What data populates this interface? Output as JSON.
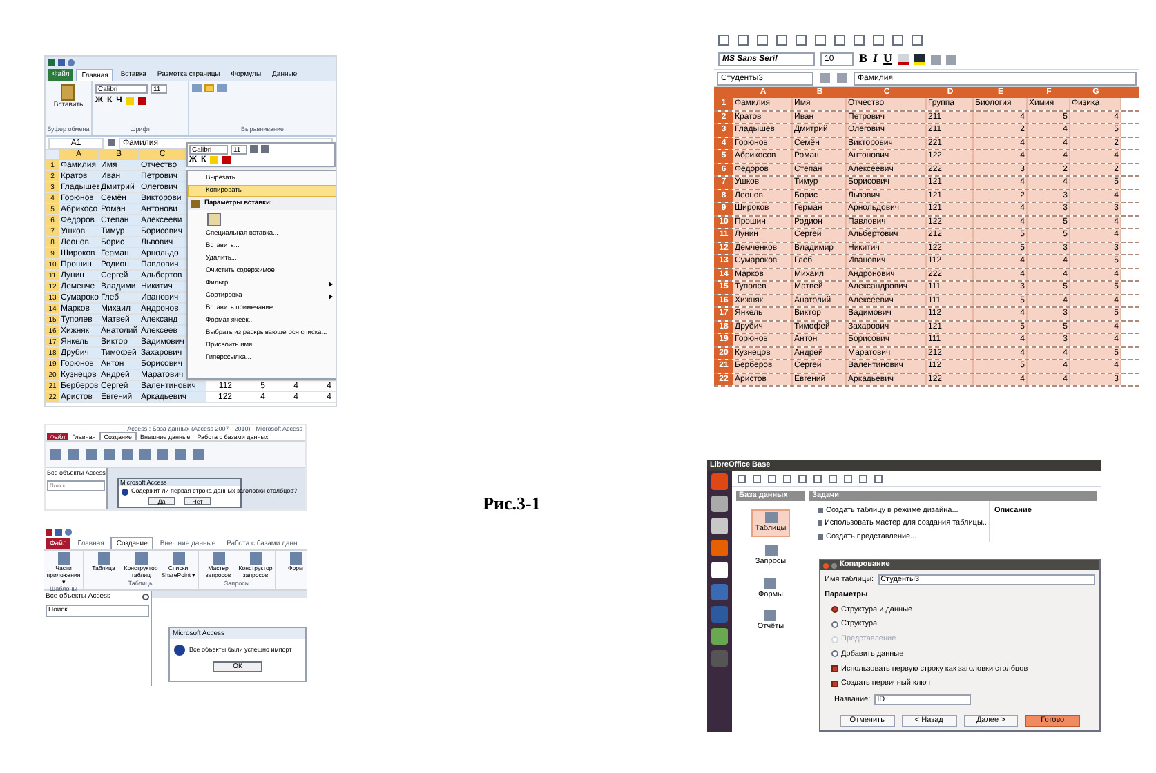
{
  "excel": {
    "tabs": [
      {
        "label": "Файл",
        "kind": "file",
        "selected": false
      },
      {
        "label": "Главная",
        "kind": "tab",
        "selected": true
      },
      {
        "label": "Вставка",
        "kind": "tab",
        "selected": false
      },
      {
        "label": "Разметка страницы",
        "kind": "tab",
        "selected": false
      },
      {
        "label": "Формулы",
        "kind": "tab",
        "selected": false
      },
      {
        "label": "Данные",
        "kind": "tab",
        "selected": false
      }
    ],
    "ribbon": {
      "paste": "Вставить",
      "font": "Calibri",
      "size": "11",
      "format_buttons": [
        "Ж",
        "К",
        "Ч"
      ],
      "groups": [
        "Буфер обмена",
        "Шрифт",
        "Выравнивание"
      ]
    },
    "name_box": "A1",
    "formula": "Фамилия",
    "columns": [
      "A",
      "B",
      "C"
    ],
    "rows": [
      {
        "number": "1",
        "cells": [
          "Фамилия",
          "Имя",
          "Отчество"
        ]
      },
      {
        "number": "2",
        "cells": [
          "Кратов",
          "Иван",
          "Петрович"
        ]
      },
      {
        "number": "3",
        "cells": [
          "Гладышев",
          "Дмитрий",
          "Олегович"
        ]
      },
      {
        "number": "4",
        "cells": [
          "Горюнов",
          "Семён",
          "Викторови"
        ]
      },
      {
        "number": "5",
        "cells": [
          "Абрикосо",
          "Роман",
          "Антонови"
        ]
      },
      {
        "number": "6",
        "cells": [
          "Федоров",
          "Степан",
          "Алексееви"
        ]
      },
      {
        "number": "7",
        "cells": [
          "Ушков",
          "Тимур",
          "Борисович"
        ]
      },
      {
        "number": "8",
        "cells": [
          "Леонов",
          "Борис",
          "Львович"
        ]
      },
      {
        "number": "9",
        "cells": [
          "Широков",
          "Герман",
          "Арнольдо"
        ]
      },
      {
        "number": "10",
        "cells": [
          "Прошин",
          "Родион",
          "Павлович"
        ]
      },
      {
        "number": "11",
        "cells": [
          "Лунин",
          "Сергей",
          "Альбертов"
        ]
      },
      {
        "number": "12",
        "cells": [
          "Деменче",
          "Владими",
          "Никитич"
        ]
      },
      {
        "number": "13",
        "cells": [
          "Сумароко",
          "Глеб",
          "Иванович"
        ]
      },
      {
        "number": "14",
        "cells": [
          "Марков",
          "Михаил",
          "Андронов"
        ]
      },
      {
        "number": "15",
        "cells": [
          "Туполев",
          "Матвей",
          "Александ"
        ]
      },
      {
        "number": "16",
        "cells": [
          "Хижняк",
          "Анатолий",
          "Алексеев"
        ]
      },
      {
        "number": "17",
        "cells": [
          "Янкель",
          "Виктор",
          "Вадимович"
        ]
      },
      {
        "number": "18",
        "cells": [
          "Друбич",
          "Тимофей",
          "Захарович"
        ]
      },
      {
        "number": "19",
        "cells": [
          "Горюнов",
          "Антон",
          "Борисович"
        ]
      },
      {
        "number": "20",
        "cells": [
          "Кузнецов",
          "Андрей",
          "Маратович"
        ]
      },
      {
        "number": "21",
        "cells": [
          "Берберов",
          "Сергей",
          "Валентинович",
          "112",
          "5",
          "4",
          "4"
        ]
      },
      {
        "number": "22",
        "cells": [
          "Аристов",
          "Евгений",
          "Аркадьевич",
          "122",
          "4",
          "4",
          "4"
        ]
      }
    ],
    "mini_toolbar": {
      "font": "Calibri",
      "size": "11",
      "format_buttons": [
        "Ж",
        "К"
      ]
    },
    "context_menu": [
      {
        "label": "Вырезать",
        "kind": "item",
        "selected": false
      },
      {
        "label": "Копировать",
        "kind": "item",
        "selected": true
      },
      {
        "label": "Параметры вставки:",
        "kind": "header"
      },
      {
        "kind": "icons"
      },
      {
        "label": "Специальная вставка...",
        "kind": "item",
        "selected": false
      },
      {
        "label": "Вставить...",
        "kind": "item",
        "selected": false
      },
      {
        "label": "Удалить...",
        "kind": "item",
        "selected": false
      },
      {
        "label": "Очистить содержимое",
        "kind": "item",
        "selected": false
      },
      {
        "label": "Фильтр",
        "kind": "submenu",
        "selected": false
      },
      {
        "label": "Сортировка",
        "kind": "submenu",
        "selected": false
      },
      {
        "label": "Вставить примечание",
        "kind": "item",
        "selected": false
      },
      {
        "label": "Формат ячеек...",
        "kind": "item",
        "selected": false
      },
      {
        "label": "Выбрать из раскрывающегося списка...",
        "kind": "item",
        "selected": false
      },
      {
        "label": "Присвоить имя...",
        "kind": "item",
        "selected": false
      },
      {
        "label": "Гиперссылка...",
        "kind": "item",
        "selected": false
      }
    ]
  },
  "access_prompt": {
    "window_title": "Access : База данных (Access 2007 - 2010) - Microsoft Access",
    "tabs": [
      {
        "label": "Файл",
        "kind": "file",
        "selected": false
      },
      {
        "label": "Главная",
        "kind": "tab",
        "selected": false
      },
      {
        "label": "Создание",
        "kind": "tab",
        "selected": true
      },
      {
        "label": "Внешние данные",
        "kind": "tab",
        "selected": false
      },
      {
        "label": "Работа с базами данных",
        "kind": "tab",
        "selected": false
      }
    ],
    "navigation": {
      "title": "Все объекты Access",
      "search_placeholder": "Поиск..."
    },
    "dialog": {
      "title": "Microsoft Access",
      "message": "Содержит ли первая строка данных заголовки столбцов?",
      "buttons": [
        "Да",
        "Нет"
      ]
    }
  },
  "access_done": {
    "tabs": [
      {
        "label": "Файл",
        "kind": "file",
        "selected": false
      },
      {
        "label": "Главная",
        "kind": "tab",
        "selected": false
      },
      {
        "label": "Создание",
        "kind": "tab",
        "selected": true
      },
      {
        "label": "Внешние данные",
        "kind": "tab",
        "selected": false
      },
      {
        "label": "Работа с базами данн",
        "kind": "tab",
        "selected": false
      }
    ],
    "ribbon_groups": [
      {
        "label": "Шаблоны",
        "commands": [
          "Части приложения ▾"
        ]
      },
      {
        "label": "Таблицы",
        "commands": [
          "Таблица",
          "Конструктор таблиц",
          "Списки SharePoint ▾"
        ]
      },
      {
        "label": "Запросы",
        "commands": [
          "Мастер запросов",
          "Конструктор запросов"
        ]
      },
      {
        "commands": [
          "Форм"
        ]
      }
    ],
    "navigation": {
      "title": "Все объекты Access",
      "search_placeholder": "Поиск..."
    },
    "dialog": {
      "title": "Microsoft Access",
      "message": "Все объекты были успешно импорт",
      "button": "ОК"
    }
  },
  "caption": "Рис.3-1",
  "calc": {
    "font": "MS Sans Serif",
    "size": "10",
    "format_buttons": [
      "B",
      "I",
      "U"
    ],
    "name_box": "Студенты3",
    "formula": "Фамилия",
    "columns": [
      "A",
      "B",
      "C",
      "D",
      "E",
      "F",
      "G"
    ],
    "rows": [
      {
        "number": "1",
        "cells": [
          "Фамилия",
          "Имя",
          "Отчество",
          "Группа",
          "Биология",
          "Химия",
          "Физика"
        ]
      },
      {
        "number": "2",
        "cells": [
          "Кратов",
          "Иван",
          "Петрович",
          "211",
          "4",
          "5",
          "4"
        ]
      },
      {
        "number": "3",
        "cells": [
          "Гладышев",
          "Дмитрий",
          "Олегович",
          "211",
          "2",
          "4",
          "5"
        ]
      },
      {
        "number": "4",
        "cells": [
          "Горюнов",
          "Семён",
          "Викторович",
          "221",
          "4",
          "4",
          "2"
        ]
      },
      {
        "number": "5",
        "cells": [
          "Абрикосов",
          "Роман",
          "Антонович",
          "122",
          "4",
          "4",
          "4"
        ]
      },
      {
        "number": "6",
        "cells": [
          "Федоров",
          "Степан",
          "Алексеевич",
          "222",
          "3",
          "2",
          "2"
        ]
      },
      {
        "number": "7",
        "cells": [
          "Ушков",
          "Тимур",
          "Борисович",
          "121",
          "4",
          "4",
          "5"
        ]
      },
      {
        "number": "8",
        "cells": [
          "Леонов",
          "Борис",
          "Львович",
          "121",
          "2",
          "3",
          "4"
        ]
      },
      {
        "number": "9",
        "cells": [
          "Широков",
          "Герман",
          "Арнольдович",
          "121",
          "4",
          "3",
          "3"
        ]
      },
      {
        "number": "10",
        "cells": [
          "Прошин",
          "Родион",
          "Павлович",
          "122",
          "4",
          "5",
          "4"
        ]
      },
      {
        "number": "11",
        "cells": [
          "Лунин",
          "Сергей",
          "Альбертович",
          "212",
          "5",
          "5",
          "4"
        ]
      },
      {
        "number": "12",
        "cells": [
          "Демченков",
          "Владимир",
          "Никитич",
          "122",
          "5",
          "3",
          "3"
        ]
      },
      {
        "number": "13",
        "cells": [
          "Сумароков",
          "Глеб",
          "Иванович",
          "112",
          "4",
          "4",
          "5"
        ]
      },
      {
        "number": "14",
        "cells": [
          "Марков",
          "Михаил",
          "Андронович",
          "222",
          "4",
          "4",
          "4"
        ]
      },
      {
        "number": "15",
        "cells": [
          "Туполев",
          "Матвей",
          "Александрович",
          "111",
          "3",
          "5",
          "5"
        ]
      },
      {
        "number": "16",
        "cells": [
          "Хижняк",
          "Анатолий",
          "Алексеевич",
          "111",
          "5",
          "4",
          "4"
        ]
      },
      {
        "number": "17",
        "cells": [
          "Янкель",
          "Виктор",
          "Вадимович",
          "112",
          "4",
          "3",
          "5"
        ]
      },
      {
        "number": "18",
        "cells": [
          "Друбич",
          "Тимофей",
          "Захарович",
          "121",
          "5",
          "5",
          "4"
        ]
      },
      {
        "number": "19",
        "cells": [
          "Горюнов",
          "Антон",
          "Борисович",
          "111",
          "4",
          "3",
          "4"
        ]
      },
      {
        "number": "20",
        "cells": [
          "Кузнецов",
          "Андрей",
          "Маратович",
          "212",
          "4",
          "4",
          "5"
        ]
      },
      {
        "number": "21",
        "cells": [
          "Берберов",
          "Сергей",
          "Валентинович",
          "112",
          "5",
          "4",
          "4"
        ]
      },
      {
        "number": "22",
        "cells": [
          "Аристов",
          "Евгений",
          "Аркадьевич",
          "122",
          "4",
          "4",
          "3"
        ]
      }
    ]
  },
  "base": {
    "window_title": "LibreOffice Base",
    "database_header": "База данных",
    "tasks_header": "Задачи",
    "sections": [
      {
        "label": "Таблицы",
        "selected": true
      },
      {
        "label": "Запросы",
        "selected": false
      },
      {
        "label": "Формы",
        "selected": false
      },
      {
        "label": "Отчёты",
        "selected": false
      }
    ],
    "tasks": [
      "Создать таблицу в режиме дизайна...",
      "Использовать мастер для создания таблицы...",
      "Создать представление..."
    ],
    "description_label": "Описание",
    "dialog": {
      "title": "Копирование",
      "table_name_label": "Имя таблицы:",
      "table_name": "Студенты3",
      "options_header": "Параметры",
      "options": [
        {
          "label": "Структура и данные",
          "kind": "radio",
          "selected": true,
          "disabled": false
        },
        {
          "label": "Структура",
          "kind": "radio",
          "selected": false,
          "disabled": false
        },
        {
          "label": "Представление",
          "kind": "radio",
          "selected": false,
          "disabled": true
        },
        {
          "label": "Добавить данные",
          "kind": "radio",
          "selected": false,
          "disabled": false
        },
        {
          "label": "Использовать первую строку как заголовки столбцов",
          "kind": "checkbox",
          "selected": true,
          "disabled": false
        },
        {
          "label": "Создать первичный ключ",
          "kind": "checkbox",
          "selected": true,
          "disabled": false
        }
      ],
      "key_name_label": "Название:",
      "key_name": "ID",
      "buttons": [
        {
          "label": "Отменить",
          "kind": "normal"
        },
        {
          "label": "< Назад",
          "kind": "normal"
        },
        {
          "label": "Далее >",
          "kind": "normal"
        },
        {
          "label": "Готово",
          "kind": "primary"
        }
      ]
    }
  }
}
